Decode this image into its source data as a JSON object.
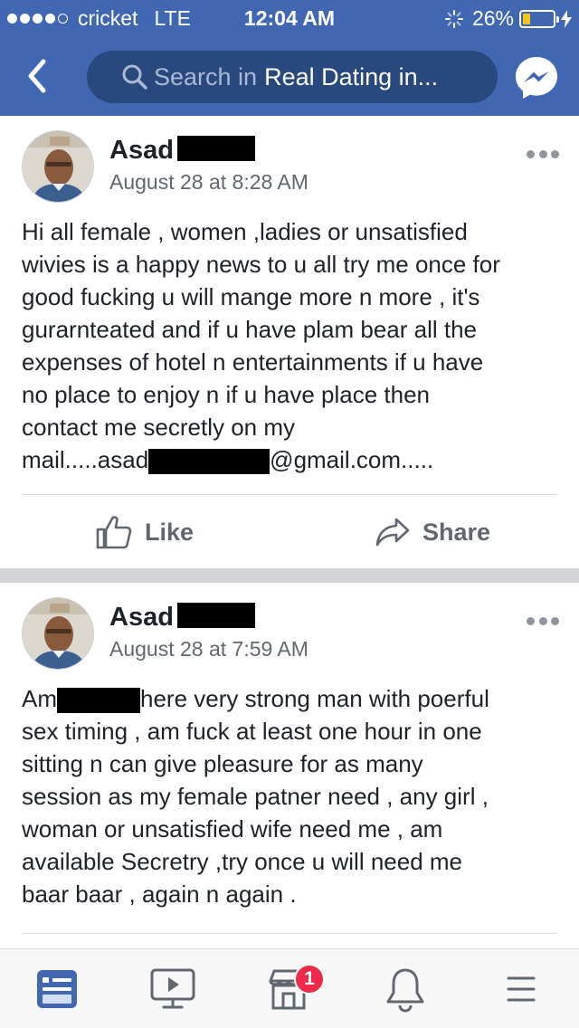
{
  "status_bar": {
    "carrier": "cricket",
    "network": "LTE",
    "time": "12:04 AM",
    "battery": "26%",
    "battery_level": 0.26
  },
  "header": {
    "search_placeholder": "Search in",
    "group_name": "Real Dating in..."
  },
  "posts": [
    {
      "author": "Asad",
      "timestamp": "August 28 at 8:28 AM",
      "body_lines": [
        "Hi all female , women ,ladies or unsatisfied",
        "wivies is a happy news to u all try me once for",
        "good fucking u will mange more n more , it's",
        "gurarnteated  and if u have plam bear all the",
        "expenses of hotel n entertainments if u have",
        "no place to enjoy n if u have place then",
        "contact me secretly on my"
      ],
      "email_prefix": "mail.....asad",
      "email_suffix": "@gmail.com....."
    },
    {
      "author": "Asad",
      "timestamp": "August 28 at 7:59 AM",
      "first_line_prefix": "Am",
      "first_line_suffix": "here very strong man with poerful",
      "body_lines": [
        "sex timing , am fuck at least one hour in one",
        "sitting n can give pleasure for as many",
        "session as my female patner need , any girl ,",
        "woman or unsatisfied wife need me , am",
        "available Secretry ,try once u will need me",
        "baar baar , again n again ."
      ]
    }
  ],
  "actions": {
    "like": "Like",
    "share": "Share"
  },
  "bottom_nav": {
    "items": [
      "news-feed-icon",
      "watch-icon",
      "marketplace-icon",
      "notifications-icon",
      "menu-icon"
    ],
    "marketplace_badge": "1"
  },
  "colors": {
    "brand": "#4267b2",
    "search_bg": "#29487d",
    "badge": "#f02849"
  }
}
